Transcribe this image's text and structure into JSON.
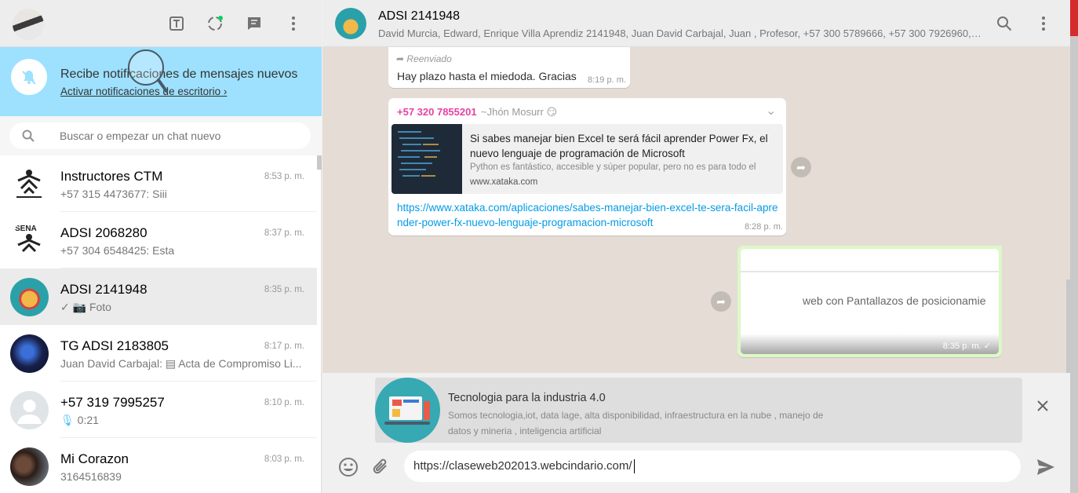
{
  "sidebar": {
    "notification": {
      "title": "Recibe notificaciones de mensajes nuevos",
      "link": "Activar notificaciones de escritorio"
    },
    "search": {
      "placeholder": "Buscar o empezar un chat nuevo"
    },
    "chats": [
      {
        "name": "Instructores CTM",
        "time": "8:53 p. m.",
        "preview": "+57 315 4473677: Siii"
      },
      {
        "name": "ADSI 2068280",
        "time": "8:37 p. m.",
        "preview": "+57 304 6548425: Esta"
      },
      {
        "name": "ADSI 2141948",
        "time": "8:35 p. m.",
        "preview": "Foto"
      },
      {
        "name": "TG ADSI 2183805",
        "time": "8:17 p. m.",
        "preview": "Juan David Carbajal: ▤ Acta de Compromiso Li..."
      },
      {
        "name": "+57 319 7995257",
        "time": "8:10 p. m.",
        "preview": "0:21"
      },
      {
        "name": "Mi Corazon",
        "time": "8:03 p. m.",
        "preview": "3164516839"
      }
    ]
  },
  "conversation": {
    "title": "ADSI 2141948",
    "members": "David Murcia, Edward, Enrique Villa Aprendiz 2141948, Juan David Carbajal, Juan , Profesor, +57 300 5789666, +57 300 7926960, +...",
    "messages": {
      "m1": {
        "forwarded": "Reenviado",
        "text": "Hay plazo hasta el miedoda. Gracias",
        "time": "8:19 p. m."
      },
      "m2": {
        "sender": "+57 320 7855201",
        "sender_name": "~Jhón Mosurr",
        "link_title": "Si sabes manejar bien Excel te será fácil aprender Power Fx, el nuevo lenguaje de programación de Microsoft",
        "link_desc": "Python es fantástico, accesible y súper popular, pero no es para todo el",
        "link_domain": "www.xataka.com",
        "url": "https://www.xataka.com/aplicaciones/sabes-manejar-bien-excel-te-sera-facil-aprender-power-fx-nuevo-lenguaje-programacion-microsoft",
        "time": "8:28 p. m."
      },
      "m3": {
        "image_text": "web con Pantallazos de posicionamie",
        "time": "8:35 p. m."
      }
    }
  },
  "compose": {
    "preview_title": "Tecnologia para la industria 4.0",
    "preview_desc": "Somos tecnologia,iot, data lage, alta disponibilidad, infraestructura en la nube , manejo de datos y mineria , inteligencia artificial",
    "input_value": "https://claseweb202013.webcindario.com/"
  },
  "colors": {
    "notification_bg": "#9de1fe",
    "sender_color": "#e542a3",
    "link_color": "#039be5",
    "outgoing_bubble": "#dcf8c6"
  }
}
